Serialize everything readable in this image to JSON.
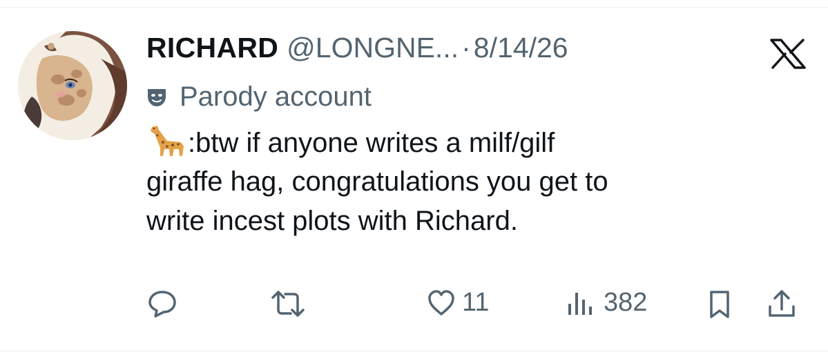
{
  "tweet": {
    "display_name": "RICHARD",
    "handle": "@LONGNE...",
    "separator": "·",
    "date": "8/14/26",
    "parody_label": "Parody account",
    "text_lines": [
      ":btw if anyone writes a milf/gilf",
      "giraffe hag, congratulations you get to",
      "write incest plots with Richard."
    ],
    "likes": "11",
    "views": "382"
  },
  "icons": {
    "platform": "x-logo-icon",
    "parody": "theater-mask-icon",
    "emoji": "giraffe-emoji-icon",
    "reply": "reply-bubble-icon",
    "retweet": "retweet-icon",
    "like": "heart-icon",
    "views": "bar-chart-icon",
    "bookmark": "bookmark-icon",
    "share": "share-upload-icon"
  },
  "colors": {
    "text_primary": "#0f1419",
    "text_secondary": "#536471",
    "divider": "#eff3f4"
  }
}
